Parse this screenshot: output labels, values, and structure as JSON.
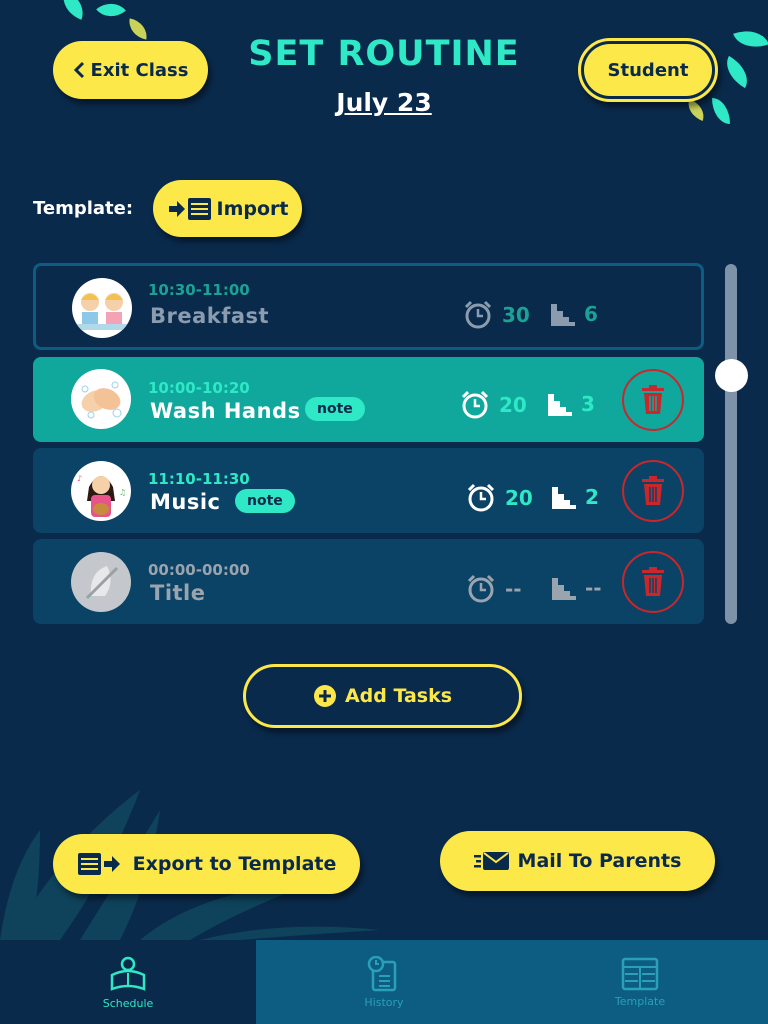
{
  "header": {
    "exit_label": "Exit Class",
    "title": "SET ROUTINE",
    "date": "July 23",
    "student_label": "Student"
  },
  "template": {
    "label": "Template:",
    "import_label": "Import"
  },
  "tasks": [
    {
      "time": "10:30-11:00",
      "name": "Breakfast",
      "note": "",
      "duration": "30",
      "steps": "6",
      "state": "outlined",
      "icon": "breakfast-kids-icon"
    },
    {
      "time": "10:00-10:20",
      "name": "Wash Hands",
      "note": "note",
      "duration": "20",
      "steps": "3",
      "state": "selected",
      "icon": "wash-hands-icon"
    },
    {
      "time": "11:10-11:30",
      "name": "Music",
      "note": "note",
      "duration": "20",
      "steps": "2",
      "state": "normal",
      "icon": "music-girl-icon"
    },
    {
      "time": "00:00-00:00",
      "name": "Title",
      "note": "",
      "duration": "--",
      "steps": "--",
      "state": "empty",
      "icon": "placeholder-icon"
    }
  ],
  "add_tasks_label": "Add Tasks",
  "export_label": "Export to Template",
  "mail_label": "Mail To Parents",
  "tabs": [
    {
      "label": "Schedule",
      "active": true
    },
    {
      "label": "History",
      "active": false
    },
    {
      "label": "Template",
      "active": false
    }
  ],
  "colors": {
    "background": "#0a2a4c",
    "accent_teal": "#2ee8c6",
    "button_yellow": "#fde84a",
    "delete_red": "#c9272b",
    "selected_row": "#10a89c"
  }
}
